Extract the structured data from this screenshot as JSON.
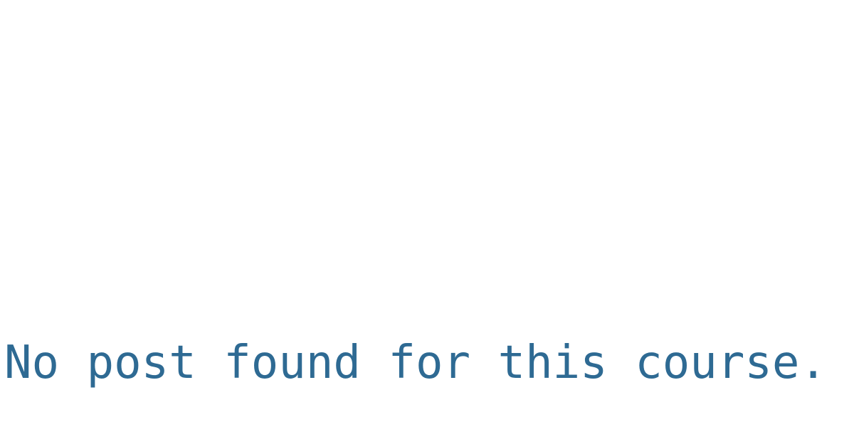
{
  "main": {
    "empty_message": "No post found for this course."
  },
  "colors": {
    "background": "#ffffff",
    "message_text": "#2e6a93"
  }
}
